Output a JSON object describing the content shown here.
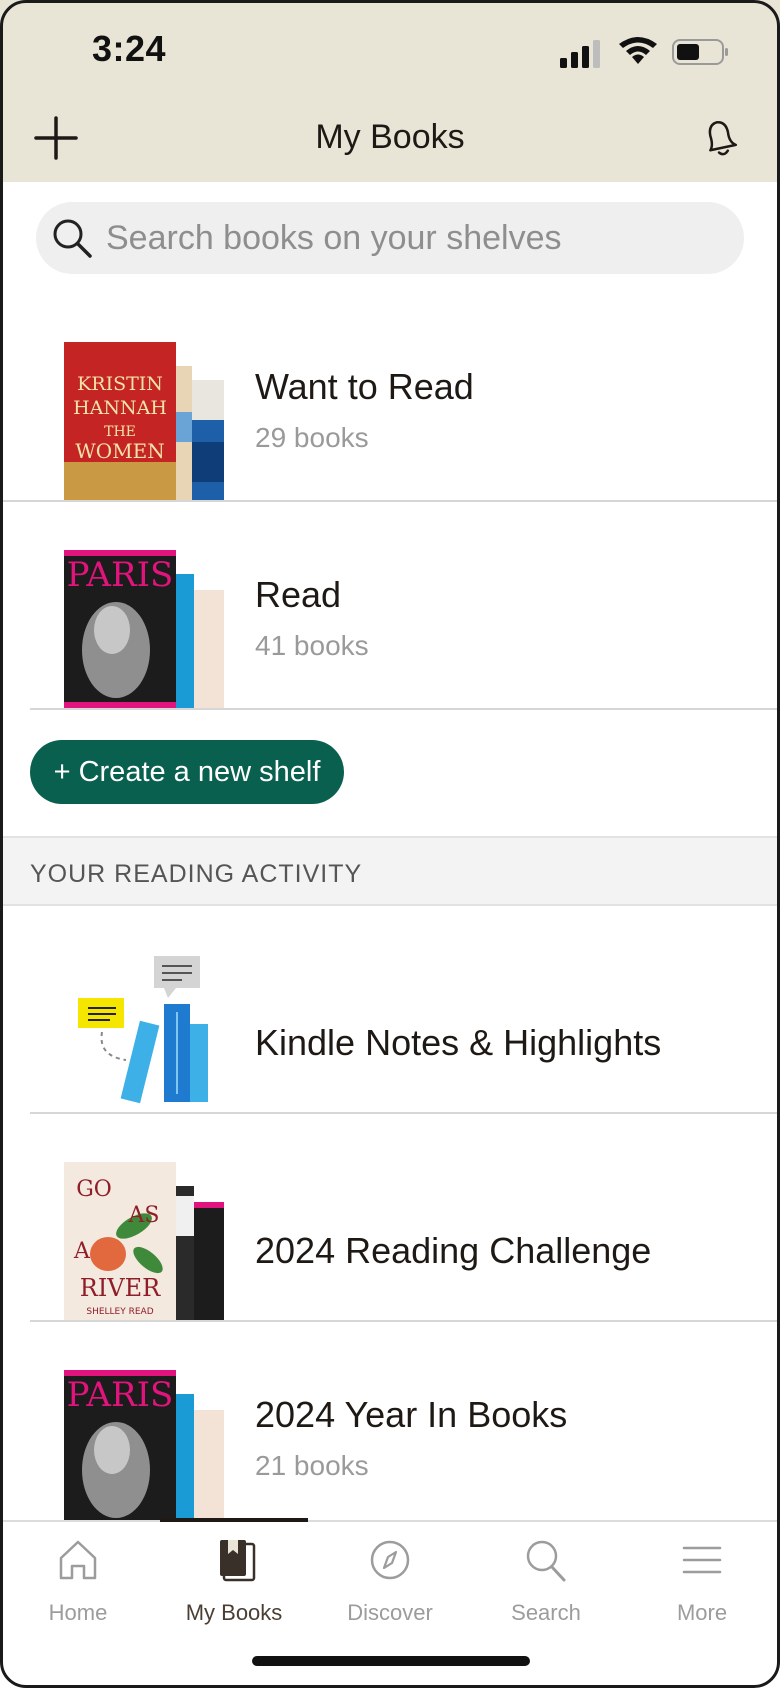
{
  "status_bar": {
    "time": "3:24"
  },
  "header": {
    "title": "My Books",
    "add_icon": "plus-icon",
    "notification_icon": "bell-icon"
  },
  "search": {
    "placeholder": "Search books on your shelves",
    "icon": "search-icon"
  },
  "shelves": [
    {
      "name": "Want to Read",
      "count": "29 books",
      "cover_text": [
        "KRISTIN",
        "HANNAH",
        "THE",
        "WOMEN"
      ]
    },
    {
      "name": "Read",
      "count": "41 books",
      "cover_text": [
        "PARIS"
      ]
    }
  ],
  "create_shelf": {
    "label": "+ Create a new shelf"
  },
  "reading_activity": {
    "header": "YOUR READING ACTIVITY",
    "items": [
      {
        "name": "Kindle Notes & Highlights",
        "count": ""
      },
      {
        "name": "2024 Reading Challenge",
        "count": "",
        "cover_text": [
          "GO",
          "AS",
          "A",
          "RIVER",
          "SHELLEY READ"
        ]
      },
      {
        "name": "2024 Year In Books",
        "count": "21 books",
        "cover_text": [
          "PARIS"
        ]
      }
    ]
  },
  "tabbar": {
    "active": "My Books",
    "tabs": [
      {
        "label": "Home",
        "icon": "home-icon"
      },
      {
        "label": "My Books",
        "icon": "book-icon"
      },
      {
        "label": "Discover",
        "icon": "compass-icon"
      },
      {
        "label": "Search",
        "icon": "search-icon"
      },
      {
        "label": "More",
        "icon": "menu-icon"
      }
    ]
  },
  "colors": {
    "header_bg": "#e9e5d6",
    "accent": "#09604f",
    "text": "#1e1915",
    "muted": "#9a9a9a"
  }
}
